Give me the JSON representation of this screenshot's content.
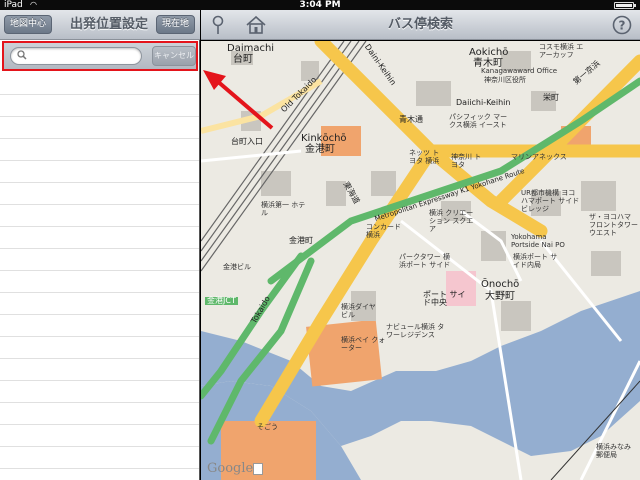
{
  "status_bar": {
    "carrier": "iPad",
    "time": "3:04 PM"
  },
  "left_panel": {
    "nav_left_button": "地図中心",
    "title": "出発位置設定",
    "nav_right_button": "現在地",
    "search": {
      "placeholder": "",
      "value": "",
      "cancel_label": "キャンセル"
    }
  },
  "map_header": {
    "title": "バス停検索"
  },
  "map": {
    "labels": {
      "daimachi_en": "Daimachi",
      "daimachi_ja": "台町",
      "aokicho_en": "Aokichō",
      "aokicho_ja": "青木町",
      "kinkocho_en": "Kinkōchō",
      "kinkocho_ja": "金港町",
      "onocho_en": "Ōnochō",
      "onocho_ja": "大野町",
      "old_tokaido": "Old Tokaido",
      "daini_keihin": "Daini-Keihin",
      "daiichi_keihin": "Daiichi-Keihin",
      "metropolitan_expressway": "Metropolitan Expressway K1 Yokohane Route",
      "tokaido": "Tokaido",
      "tokaido_ja": "東海道",
      "kinkomachi": "金港町",
      "kinko_jct": "金港JCT",
      "aokidori": "青木通",
      "eiekimae": "栄町",
      "daiichikeihin_ja": "第一京浜",
      "daimachi_iriguchi": "台町入口",
      "sogo": "そごう",
      "pacific": "パシフィック マークス横浜 イースト",
      "kanagawa_yakuba": "Kanagawaward Office",
      "kanagawa_ward_ja": "神奈川区役所",
      "yokohama_bay_quarter": "横浜ベイ クォーター",
      "yokohama_diamond": "横浜ダイヤ ビル",
      "nabule": "ナビュール横浜 タワーレジデンス",
      "portside_center": "ポート サイド中央",
      "concord": "コンカード 横浜",
      "creation_square": "横浜 クリエーション スクエア",
      "park_tower": "パークタワー 横浜ポート サイド",
      "portside_yokohama": "Yokohama Portside Nai PO",
      "yokohama_portside_ja": "横浜ポート サイド内局",
      "ur_yokohama": "UR都市機構 ヨコハマポート サイドビレッジ",
      "the_yokohama_front": "ザ・ヨコハマ フロントタワー ウエスト",
      "kinkocho_building": "金港ビル",
      "yokohama_minami": "横浜みなみ 郵便局",
      "yokohama_dai_ichi": "横浜第一 ホテル",
      "netsu": "ネッツ トヨタ 横浜",
      "kanagawa_toyota": "神奈川 トヨタ",
      "marine": "マリンアネックス",
      "cosmo": "コスモ横浜 エアーカッフ"
    },
    "google": "Google"
  },
  "colors": {
    "annotation_red": "#e4141b",
    "highway_green": "#5fb86b",
    "major_road_yellow": "#f6c64b",
    "water_blue": "#94aed0"
  }
}
